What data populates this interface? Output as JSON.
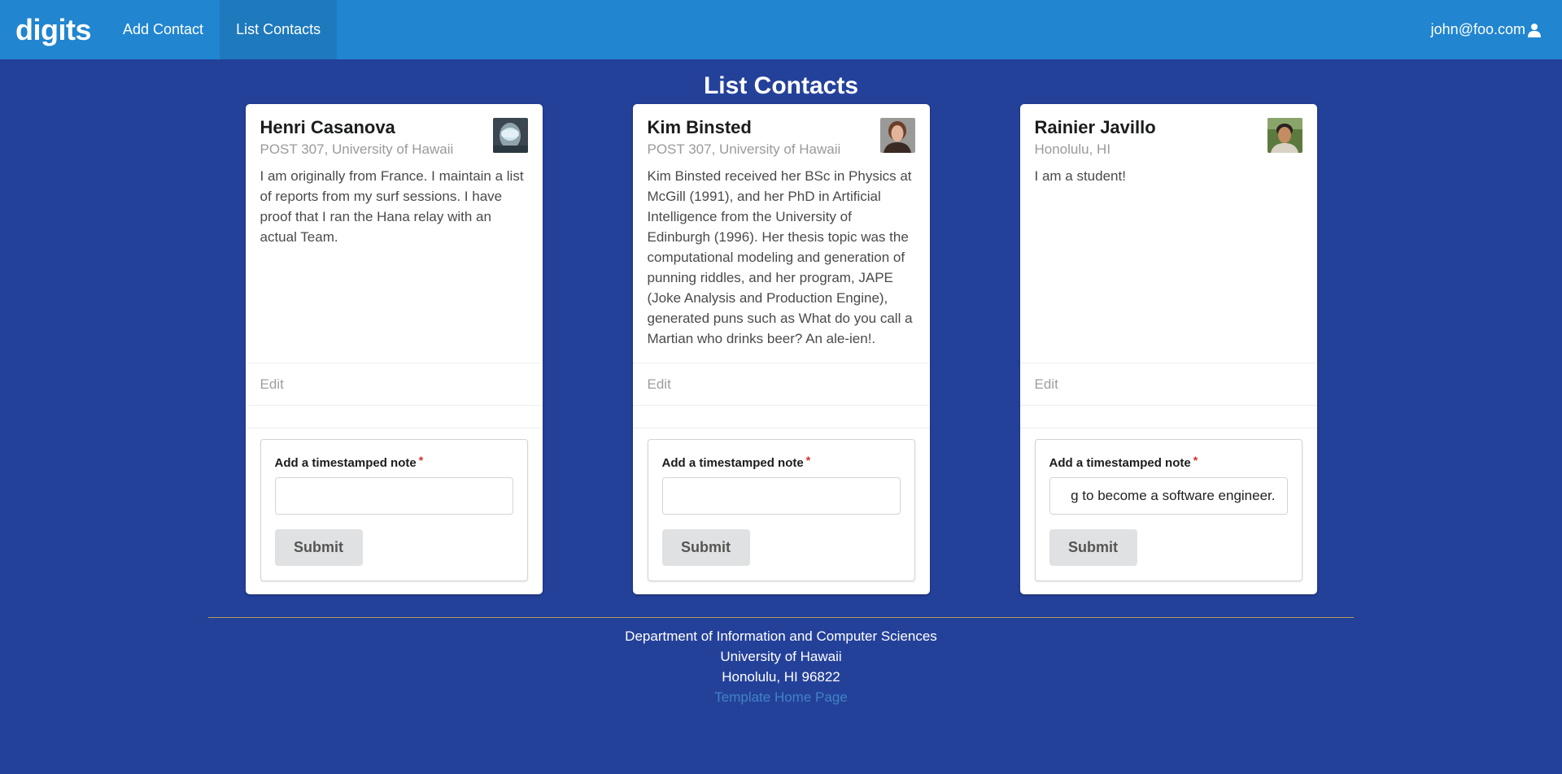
{
  "nav": {
    "brand": "digits",
    "items": [
      {
        "label": "Add Contact",
        "active": false
      },
      {
        "label": "List Contacts",
        "active": true
      }
    ],
    "user_email": "john@foo.com",
    "user_icon": "user-icon"
  },
  "page": {
    "title": "List Contacts"
  },
  "contacts": [
    {
      "name": "Henri Casanova",
      "address": "POST 307, University of Hawaii",
      "description": "I am originally from France. I maintain a list of reports from my surf sessions. I have proof that I ran the Hana relay with an actual Team.",
      "edit_label": "Edit",
      "note_label": "Add a timestamped note",
      "required_marker": "*",
      "note_value": "",
      "submit_label": "Submit"
    },
    {
      "name": "Kim Binsted",
      "address": "POST 307, University of Hawaii",
      "description": "Kim Binsted received her BSc in Physics at McGill (1991), and her PhD in Artificial Intelligence from the University of Edinburgh (1996). Her thesis topic was the computational modeling and generation of punning riddles, and her program, JAPE (Joke Analysis and Production Engine), generated puns such as What do you call a Martian who drinks beer? An ale-ien!.",
      "edit_label": "Edit",
      "note_label": "Add a timestamped note",
      "required_marker": "*",
      "note_value": "",
      "submit_label": "Submit"
    },
    {
      "name": "Rainier Javillo",
      "address": "Honolulu, HI",
      "description": "I am a student!",
      "edit_label": "Edit",
      "note_label": "Add a timestamped note",
      "required_marker": "*",
      "note_value": "g to become a software engineer.",
      "submit_label": "Submit"
    }
  ],
  "footer": {
    "line1": "Department of Information and Computer Sciences",
    "line2": "University of Hawaii",
    "line3": "Honolulu, HI 96822",
    "link": "Template Home Page"
  },
  "colors": {
    "background": "#24419a",
    "navbar": "#2185d0",
    "link": "#4183c4",
    "required": "#db2828"
  }
}
